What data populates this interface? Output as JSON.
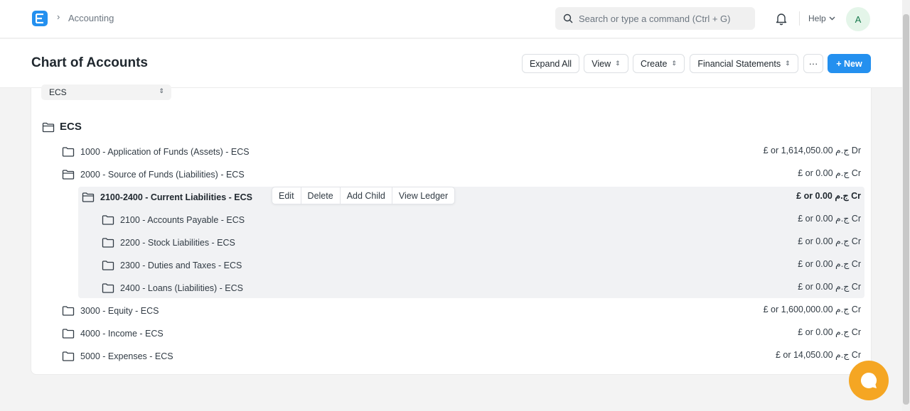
{
  "navbar": {
    "logo_letter": "E",
    "breadcrumb_separator": "›",
    "breadcrumb": "Accounting",
    "search_placeholder": "Search or type a command (Ctrl + G)",
    "help_label": "Help",
    "avatar_initial": "A"
  },
  "page": {
    "title": "Chart of Accounts",
    "buttons": {
      "expand_all": "Expand All",
      "view": "View",
      "create": "Create",
      "financial_statements": "Financial Statements",
      "more": "···",
      "new": "+ New"
    }
  },
  "filters": {
    "company": "ECS"
  },
  "tree": {
    "root_label": "ECS",
    "rows": [
      {
        "label": "1000 - Application of Funds (Assets) - ECS",
        "balance": "£ or 1,614,050.00 ج.م Dr"
      },
      {
        "label": "2000 - Source of Funds (Liabilities) - ECS",
        "balance": "£ or 0.00 ج.م Cr"
      },
      {
        "label": "2100-2400 - Current Liabilities - ECS",
        "balance": "£ or 0.00 ج.م Cr"
      },
      {
        "label": "2100 - Accounts Payable - ECS",
        "balance": "£ or 0.00 ج.م Cr"
      },
      {
        "label": "2200 - Stock Liabilities - ECS",
        "balance": "£ or 0.00 ج.م Cr"
      },
      {
        "label": "2300 - Duties and Taxes - ECS",
        "balance": "£ or 0.00 ج.م Cr"
      },
      {
        "label": "2400 - Loans (Liabilities) - ECS",
        "balance": "£ or 0.00 ج.م Cr"
      },
      {
        "label": "3000 - Equity - ECS",
        "balance": "£ or 1,600,000.00 ج.م Cr"
      },
      {
        "label": "4000 - Income - ECS",
        "balance": "£ or 0.00 ج.م Cr"
      },
      {
        "label": "5000 - Expenses - ECS",
        "balance": "£ or 14,050.00 ج.م Cr"
      }
    ],
    "row_actions": [
      "Edit",
      "Delete",
      "Add Child",
      "View Ledger"
    ]
  },
  "icons": {
    "logo": "app-logo-icon",
    "search": "search-icon",
    "bell": "bell-icon",
    "folder": "folder-icon",
    "folder_open": "folder-open-icon",
    "chat": "chat-icon"
  },
  "colors": {
    "primary": "#2490ef",
    "chat_widget": "#f5a623"
  }
}
